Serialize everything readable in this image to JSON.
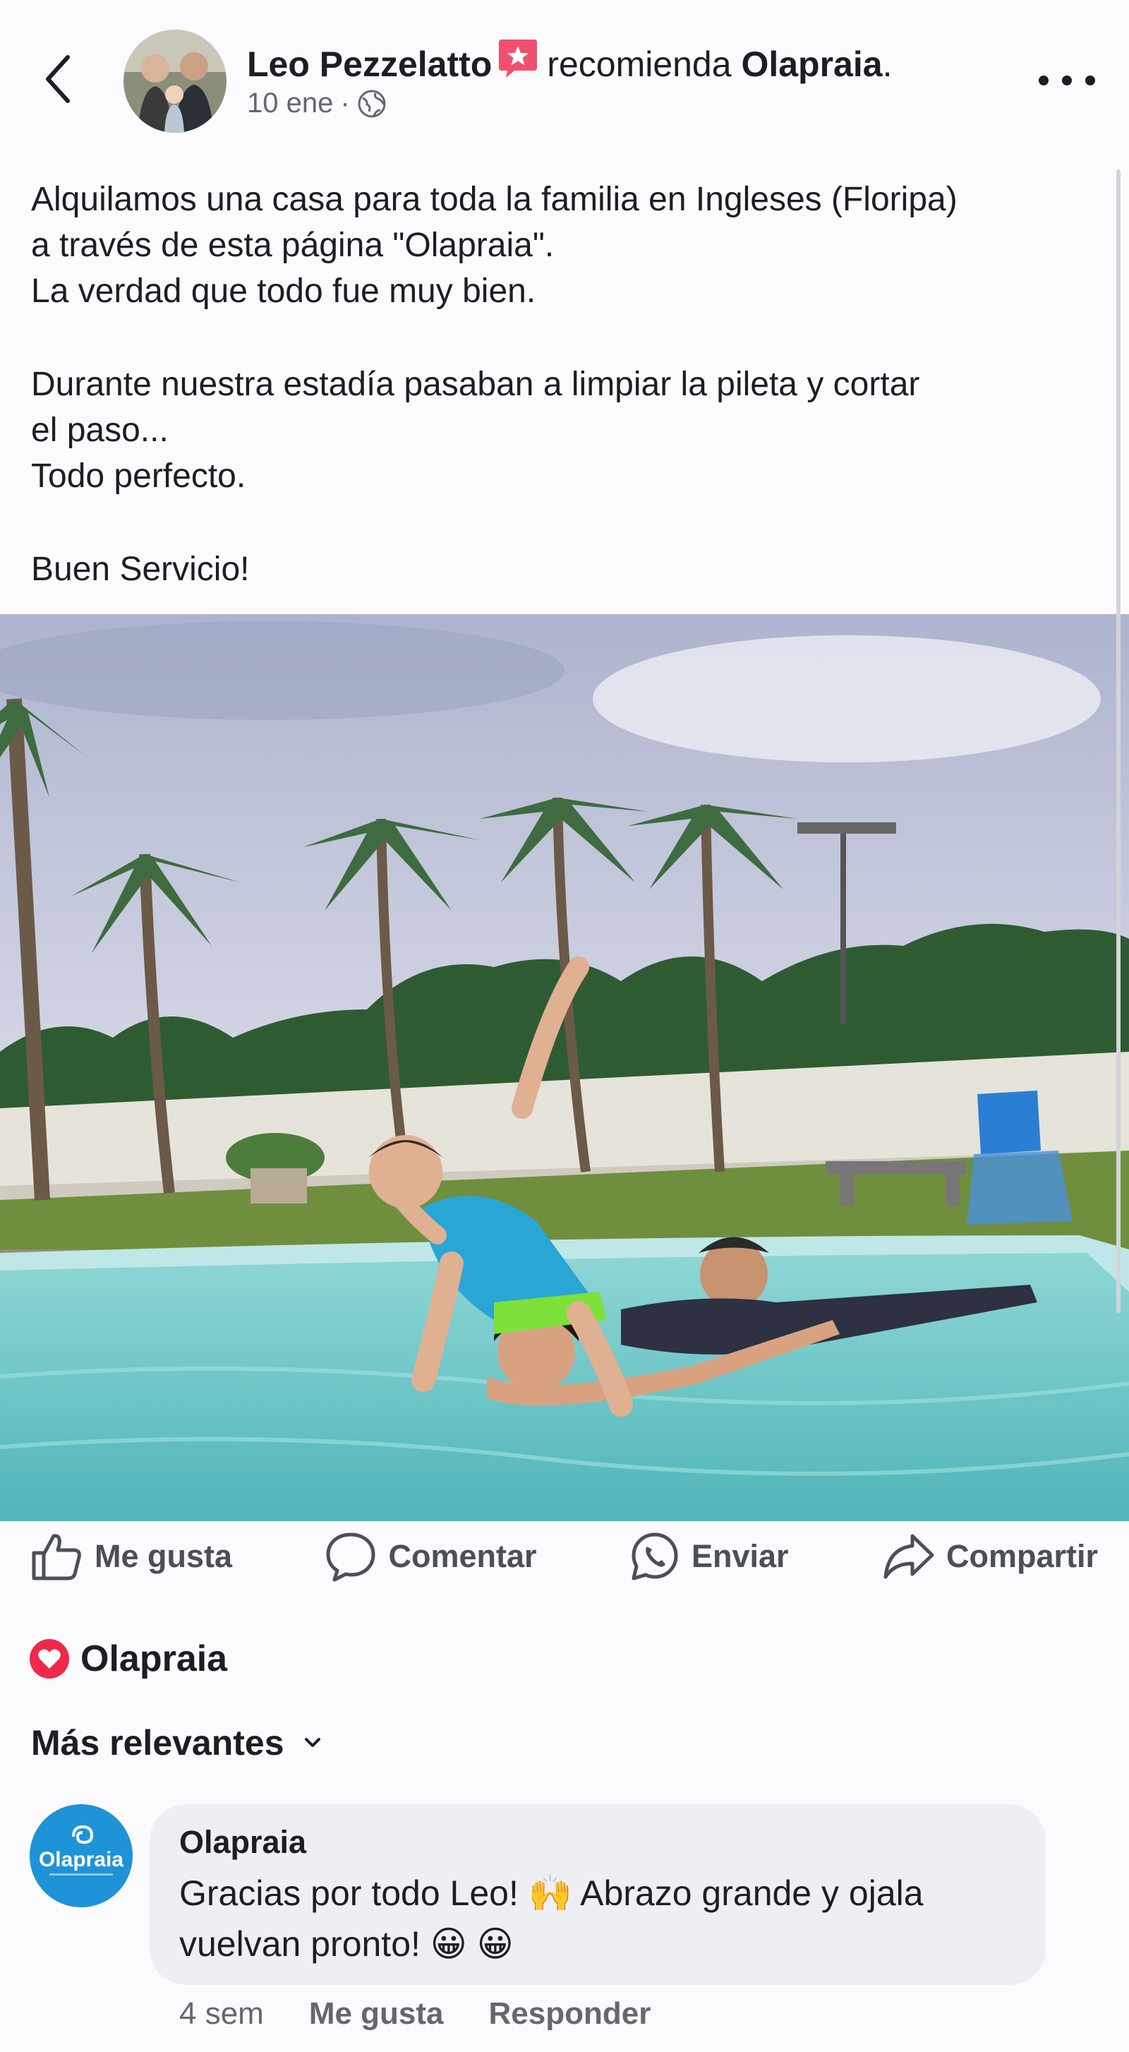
{
  "header": {
    "author_name": "Leo Pezzelatto",
    "recommend_verb": "recomienda",
    "page_name": "Olapraia",
    "date": "10 ene",
    "separator": "·",
    "privacy_icon": "globe-icon"
  },
  "post": {
    "lines": [
      "Alquilamos una casa para toda la familia en Ingleses (Floripa)",
      "a través de esta página \"Olapraia\".",
      "La verdad que todo fue muy bien.",
      "Durante nuestra estadía pasaban a limpiar la pileta y cortar",
      "el paso...",
      "Todo perfecto.",
      "Buen Servicio!"
    ]
  },
  "actions": {
    "like": "Me gusta",
    "comment": "Comentar",
    "send": "Enviar",
    "share": "Compartir"
  },
  "reactions": {
    "type": "love",
    "label": "Olapraia"
  },
  "comments_sort": {
    "label": "Más relevantes"
  },
  "comment": {
    "logo_text": "Olapraia",
    "author": "Olapraia",
    "text_line1": "Gracias por todo Leo! 🙌 Abrazo grande y ojala",
    "text_line2": "vuelvan pronto! 😀 😀",
    "time": "4 sem",
    "like": "Me gusta",
    "reply": "Responder"
  },
  "colors": {
    "text": "#1c1e21",
    "secondary": "#65676b",
    "love": "#f02849",
    "brand_blue": "#1f93d8",
    "bubble": "#eeeff3"
  }
}
